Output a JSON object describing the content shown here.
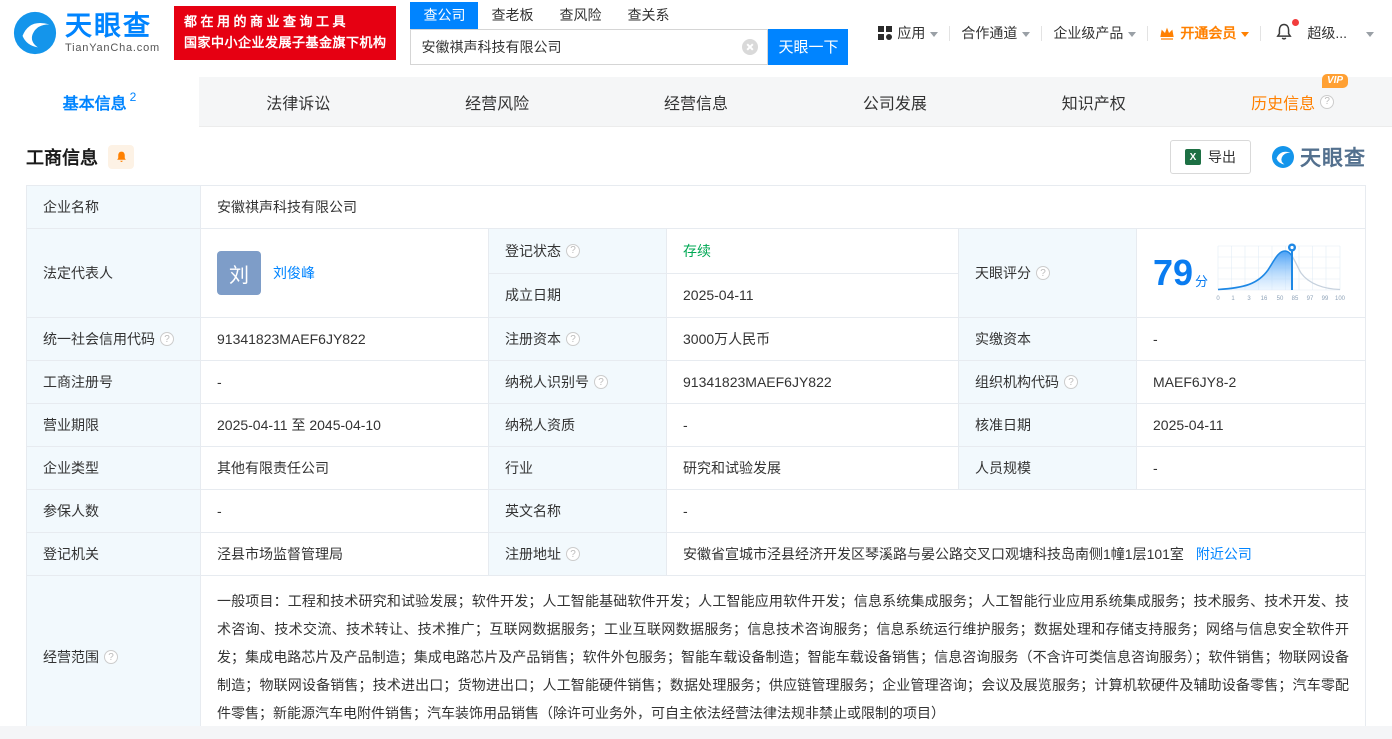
{
  "colors": {
    "brand_blue": "#0084ff",
    "status_green": "#00a854",
    "vip_orange": "#ff8000",
    "slogan_red": "#e60012",
    "label_cell_bg": "#f2f9fd"
  },
  "header": {
    "brand": "天眼查",
    "brand_domain": "TianYanCha.com",
    "slogan_line1": "都在用的商业查询工具",
    "slogan_line2": "国家中小企业发展子基金旗下机构",
    "search_tabs": [
      {
        "label": "查公司",
        "active": true
      },
      {
        "label": "查老板",
        "active": false
      },
      {
        "label": "查风险",
        "active": false
      },
      {
        "label": "查关系",
        "active": false
      }
    ],
    "search_value": "安徽祺声科技有限公司",
    "search_button": "天眼一下",
    "nav_apps": "应用",
    "nav_partner": "合作通道",
    "nav_enterprise": "企业级产品",
    "nav_member": "开通会员",
    "nav_super": "超级..."
  },
  "subnav": {
    "tabs": [
      {
        "label": "基本信息",
        "badge": "2"
      },
      {
        "label": "法律诉讼"
      },
      {
        "label": "经营风险"
      },
      {
        "label": "经营信息"
      },
      {
        "label": "公司发展"
      },
      {
        "label": "知识产权"
      },
      {
        "label": "历史信息",
        "vip": "VIP"
      }
    ]
  },
  "section": {
    "title": "工商信息",
    "export_label": "导出",
    "watermark": "天眼查"
  },
  "score": {
    "value": "79",
    "unit": "分",
    "axis": [
      "0",
      "1",
      "3",
      "16",
      "50",
      "85",
      "97",
      "99",
      "100"
    ]
  },
  "fields": {
    "company_name": {
      "label": "企业名称",
      "value": "安徽祺声科技有限公司"
    },
    "legal_rep": {
      "label": "法定代表人",
      "value": "刘俊峰",
      "avatar": "刘"
    },
    "reg_status": {
      "label": "登记状态",
      "value": "存续"
    },
    "est_date": {
      "label": "成立日期",
      "value": "2025-04-11"
    },
    "tyc_score": {
      "label": "天眼评分"
    },
    "credit_code": {
      "label": "统一社会信用代码",
      "value": "91341823MAEF6JY822"
    },
    "reg_capital": {
      "label": "注册资本",
      "value": "3000万人民币"
    },
    "paid_capital": {
      "label": "实缴资本",
      "value": "-"
    },
    "reg_number": {
      "label": "工商注册号",
      "value": "-"
    },
    "taxpayer_id": {
      "label": "纳税人识别号",
      "value": "91341823MAEF6JY822"
    },
    "org_code": {
      "label": "组织机构代码",
      "value": "MAEF6JY8-2"
    },
    "business_term": {
      "label": "营业期限",
      "value": "2025-04-11 至 2045-04-10"
    },
    "taxpayer_quality": {
      "label": "纳税人资质",
      "value": "-"
    },
    "approval_date": {
      "label": "核准日期",
      "value": "2025-04-11"
    },
    "company_type": {
      "label": "企业类型",
      "value": "其他有限责任公司"
    },
    "industry": {
      "label": "行业",
      "value": "研究和试验发展"
    },
    "staff_size": {
      "label": "人员规模",
      "value": "-"
    },
    "insured_count": {
      "label": "参保人数",
      "value": "-"
    },
    "english_name": {
      "label": "英文名称",
      "value": "-"
    },
    "reg_authority": {
      "label": "登记机关",
      "value": "泾县市场监督管理局"
    },
    "reg_address": {
      "label": "注册地址",
      "value": "安徽省宣城市泾县经济开发区琴溪路与晏公路交叉口观塘科技岛南侧1幢1层101室",
      "link": "附近公司"
    },
    "business_scope": {
      "label": "经营范围",
      "value": "一般项目：工程和技术研究和试验发展；软件开发；人工智能基础软件开发；人工智能应用软件开发；信息系统集成服务；人工智能行业应用系统集成服务；技术服务、技术开发、技术咨询、技术交流、技术转让、技术推广；互联网数据服务；工业互联网数据服务；信息技术咨询服务；信息系统运行维护服务；数据处理和存储支持服务；网络与信息安全软件开发；集成电路芯片及产品制造；集成电路芯片及产品销售；软件外包服务；智能车载设备制造；智能车载设备销售；信息咨询服务（不含许可类信息咨询服务）；软件销售；物联网设备制造；物联网设备销售；技术进出口；货物进出口；人工智能硬件销售；数据处理服务；供应链管理服务；企业管理咨询；会议及展览服务；计算机软硬件及辅助设备零售；汽车零配件零售；新能源汽车电附件销售；汽车装饰用品销售（除许可业务外，可自主依法经营法律法规非禁止或限制的项目）"
    }
  }
}
